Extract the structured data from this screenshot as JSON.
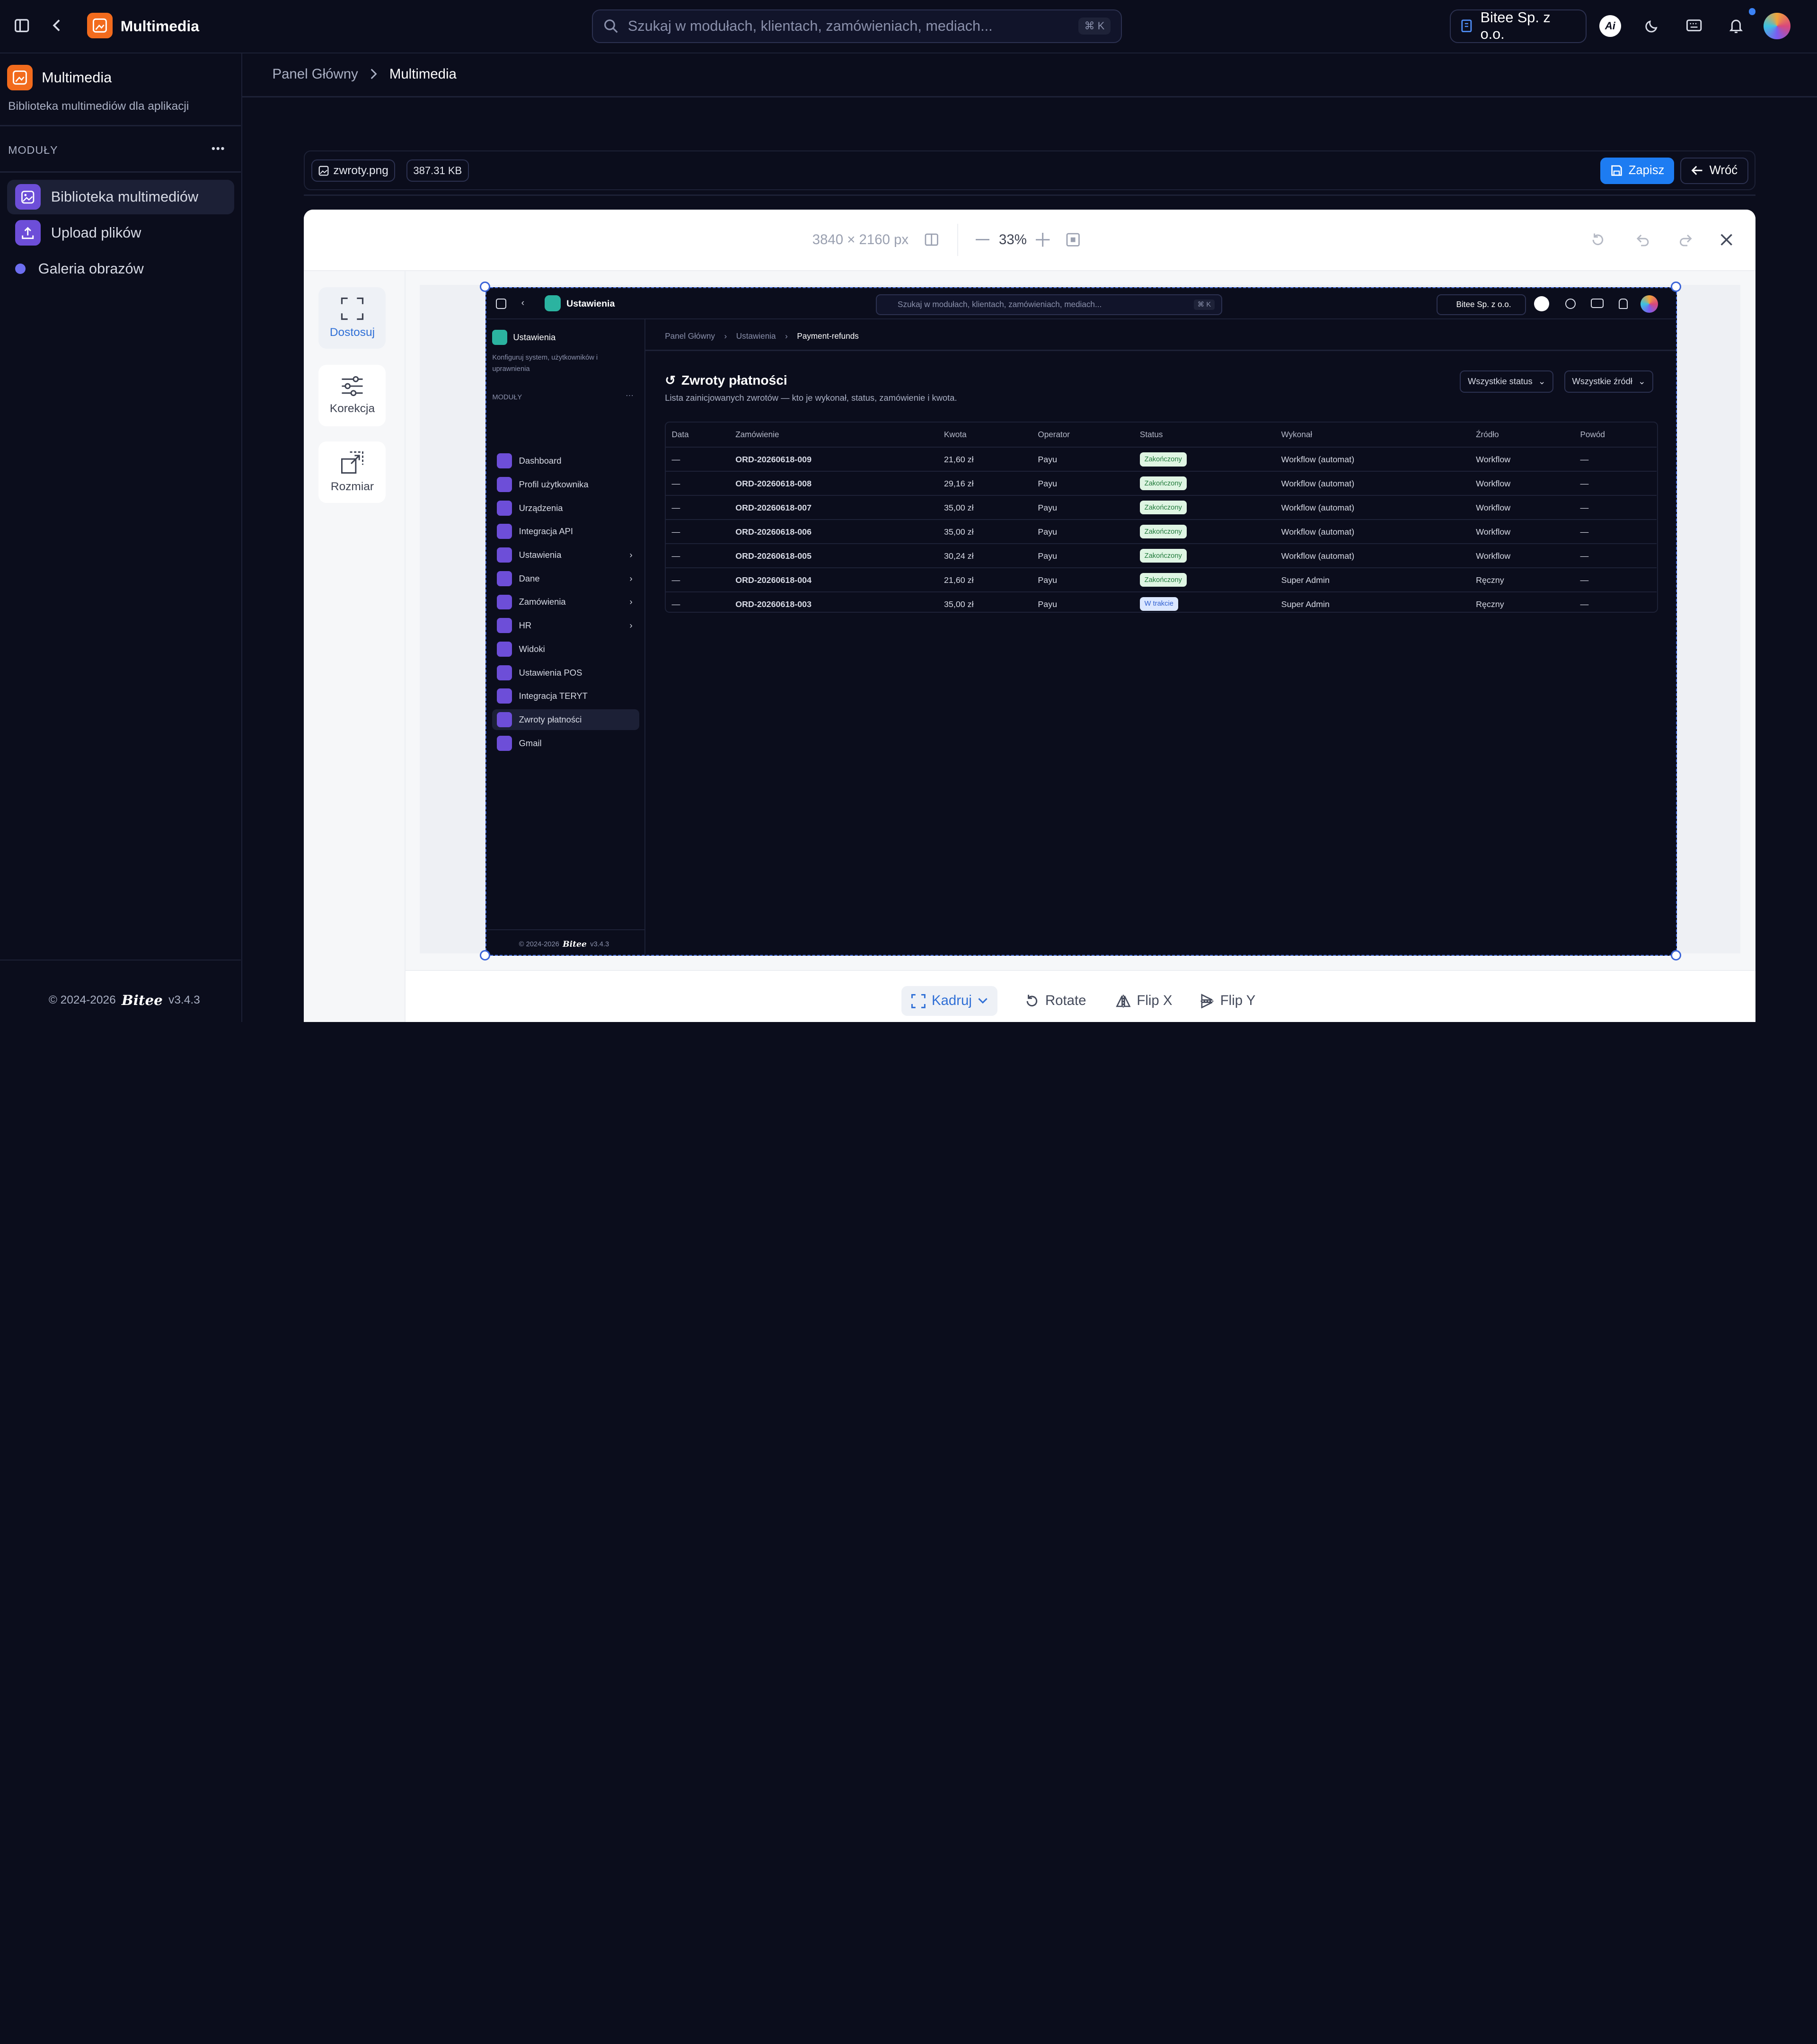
{
  "app": {
    "title": "Multimedia"
  },
  "search": {
    "placeholder": "Szukaj w modułach, klientach, zamówieniach, mediach...",
    "shortcut": "⌘ K"
  },
  "company": {
    "name": "Bitee Sp. z o.o."
  },
  "header_icons": [
    "ai-icon",
    "moon-icon",
    "keyboard-icon",
    "bell-icon",
    "avatar"
  ],
  "sidebar": {
    "module_title": "Multimedia",
    "module_desc": "Biblioteka multimediów dla aplikacji",
    "section_label": "MODUŁY",
    "items": [
      {
        "label": "Biblioteka multimediów",
        "active": true
      },
      {
        "label": "Upload plików",
        "active": false
      },
      {
        "label": "Galeria obrazów",
        "active": false
      }
    ],
    "footer_copy": "© 2024-2026",
    "footer_brand": "Bitee",
    "footer_version": "v3.4.3"
  },
  "breadcrumb": {
    "root": "Panel Główny",
    "current": "Multimedia"
  },
  "file": {
    "name": "zwroty.png",
    "size": "387.31 KB"
  },
  "actions": {
    "save": "Zapisz",
    "back": "Wróć"
  },
  "editor": {
    "dimensions": "3840 × 2160 px",
    "zoom": "33%",
    "tools": [
      {
        "label": "Dostosuj",
        "active": true
      },
      {
        "label": "Korekcja",
        "active": false
      },
      {
        "label": "Rozmiar",
        "active": false
      }
    ],
    "bottom": {
      "crop": "Kadruj",
      "rotate": "Rotate",
      "flip_x": "Flip X",
      "flip_y": "Flip Y"
    }
  },
  "preview": {
    "app_title": "Ustawienia",
    "search_placeholder": "Szukaj w modułach, klientach, zamówieniach, mediach...",
    "search_shortcut": "⌘ K",
    "company": "Bitee Sp. z o.o.",
    "module_title": "Ustawienia",
    "module_desc": "Konfiguruj system, użytkowników i uprawnienia",
    "section_label": "MODUŁY",
    "nav": [
      "Dashboard",
      "Profil użytkownika",
      "Urządzenia",
      "Integracja API",
      "Ustawienia",
      "Dane",
      "Zamówienia",
      "HR",
      "Widoki",
      "Ustawienia POS",
      "Integracja TERYT",
      "Zwroty płatności",
      "Gmail"
    ],
    "footer": "© 2024-2026",
    "footer_brand": "Bitee",
    "footer_version": "v3.4.3",
    "breadcrumb": [
      "Panel Główny",
      "Ustawienia",
      "Payment-refunds"
    ],
    "page_title": "Zwroty płatności",
    "page_desc": "Lista zainicjowanych zwrotów — kto je wykonał, status, zamówienie i kwota.",
    "filter_status": "Wszystkie status",
    "filter_source": "Wszystkie źródł",
    "columns": [
      "Data",
      "Zamówienie",
      "Kwota",
      "Operator",
      "Status",
      "Wykonał",
      "Źródło",
      "Powód"
    ],
    "rows": [
      {
        "date": "—",
        "order": "ORD-20260618-009",
        "amount": "21,60 zł",
        "operator": "Payu",
        "status": "Zakończony",
        "by": "Workflow (automat)",
        "source": "Workflow",
        "reason": "—"
      },
      {
        "date": "—",
        "order": "ORD-20260618-008",
        "amount": "29,16 zł",
        "operator": "Payu",
        "status": "Zakończony",
        "by": "Workflow (automat)",
        "source": "Workflow",
        "reason": "—"
      },
      {
        "date": "—",
        "order": "ORD-20260618-007",
        "amount": "35,00 zł",
        "operator": "Payu",
        "status": "Zakończony",
        "by": "Workflow (automat)",
        "source": "Workflow",
        "reason": "—"
      },
      {
        "date": "—",
        "order": "ORD-20260618-006",
        "amount": "35,00 zł",
        "operator": "Payu",
        "status": "Zakończony",
        "by": "Workflow (automat)",
        "source": "Workflow",
        "reason": "—"
      },
      {
        "date": "—",
        "order": "ORD-20260618-005",
        "amount": "30,24 zł",
        "operator": "Payu",
        "status": "Zakończony",
        "by": "Workflow (automat)",
        "source": "Workflow",
        "reason": "—"
      },
      {
        "date": "—",
        "order": "ORD-20260618-004",
        "amount": "21,60 zł",
        "operator": "Payu",
        "status": "Zakończony",
        "by": "Super Admin",
        "source": "Ręczny",
        "reason": "—"
      },
      {
        "date": "—",
        "order": "ORD-20260618-003",
        "amount": "35,00 zł",
        "operator": "Payu",
        "status": "W trakcie",
        "by": "Super Admin",
        "source": "Ręczny",
        "reason": "—"
      }
    ]
  },
  "colors": {
    "bg": "#0b0d1c",
    "accent": "#f26b1d",
    "primary": "#1d7cf2",
    "purple": "#6d4ed8",
    "teal": "#2bb3a0"
  }
}
